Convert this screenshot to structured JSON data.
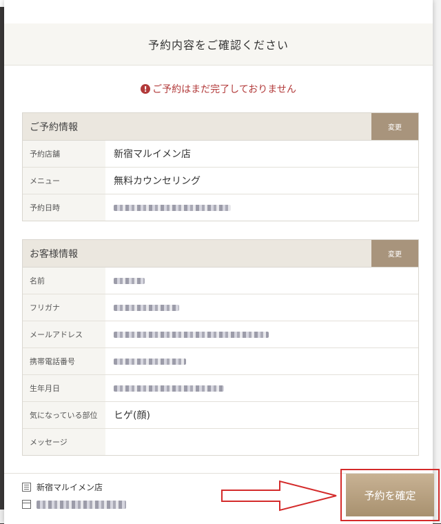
{
  "modal": {
    "title": "予約内容をご確認ください",
    "warning": "ご予約はまだ完了しておりません",
    "warning_icon": "exclamation-circle-icon"
  },
  "reservation": {
    "heading": "ご予約情報",
    "change_label": "変更",
    "rows": [
      {
        "label": "予約店舗",
        "value": "新宿マルイメン店"
      },
      {
        "label": "メニュー",
        "value": "無料カウンセリング"
      },
      {
        "label": "予約日時",
        "value": ""
      }
    ]
  },
  "customer": {
    "heading": "お客様情報",
    "change_label": "変更",
    "rows": [
      {
        "label": "名前",
        "value": ""
      },
      {
        "label": "フリガナ",
        "value": ""
      },
      {
        "label": "メールアドレス",
        "value": ""
      },
      {
        "label": "携帯電話番号",
        "value": ""
      },
      {
        "label": "生年月日",
        "value": ""
      },
      {
        "label": "気になっている部位",
        "value": "ヒゲ(顔)"
      },
      {
        "label": "メッセージ",
        "value": ""
      }
    ]
  },
  "footer": {
    "shop": "新宿マルイメン店",
    "confirm_label": "予約を確定"
  },
  "colors": {
    "accent": "#a8947c",
    "warning": "#b23a3a",
    "highlight_red": "#d42a2a"
  }
}
